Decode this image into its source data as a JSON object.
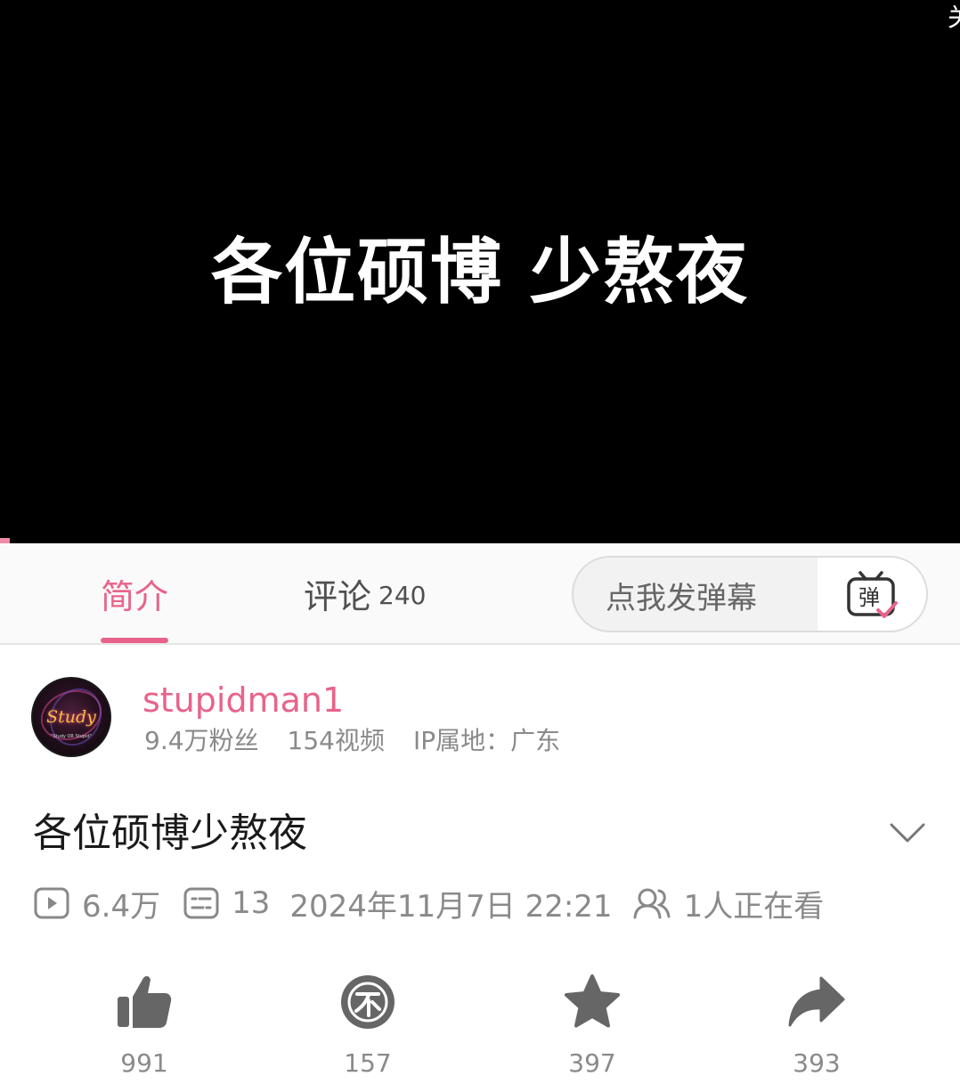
{
  "player": {
    "caption": "各位硕博 少熬夜",
    "corner_text": "关",
    "progress_percent": 1
  },
  "tabs": {
    "intro_label": "简介",
    "comments_label": "评论",
    "comments_count": "240",
    "danmaku_placeholder": "点我发弹幕",
    "danmaku_toggle_glyph": "弹"
  },
  "uploader": {
    "avatar_text": "Study",
    "avatar_subtext": "\"Study OR Stupid\"",
    "name": "stupidman1",
    "followers": "9.4万粉丝",
    "videos": "154视频",
    "ip": "IP属地：广东"
  },
  "video": {
    "title": "各位硕博少熬夜",
    "views": "6.4万",
    "danmaku_count": "13",
    "publish_time": "2024年11月7日 22:21",
    "watching": "1人正在看"
  },
  "actions": {
    "like_count": "991",
    "coin_count": "157",
    "favorite_count": "397",
    "share_count": "393"
  },
  "icons": {
    "play": "play-icon",
    "danmaku": "danmaku-list-icon",
    "viewers": "viewers-icon",
    "expand": "chevron-down-icon",
    "like": "thumbs-up-icon",
    "coin": "coin-icon",
    "favorite": "star-icon",
    "share": "share-icon"
  },
  "colors": {
    "accent_pink": "#e8638a",
    "icon_gray": "#666666",
    "text_gray": "#8a8a8a"
  }
}
